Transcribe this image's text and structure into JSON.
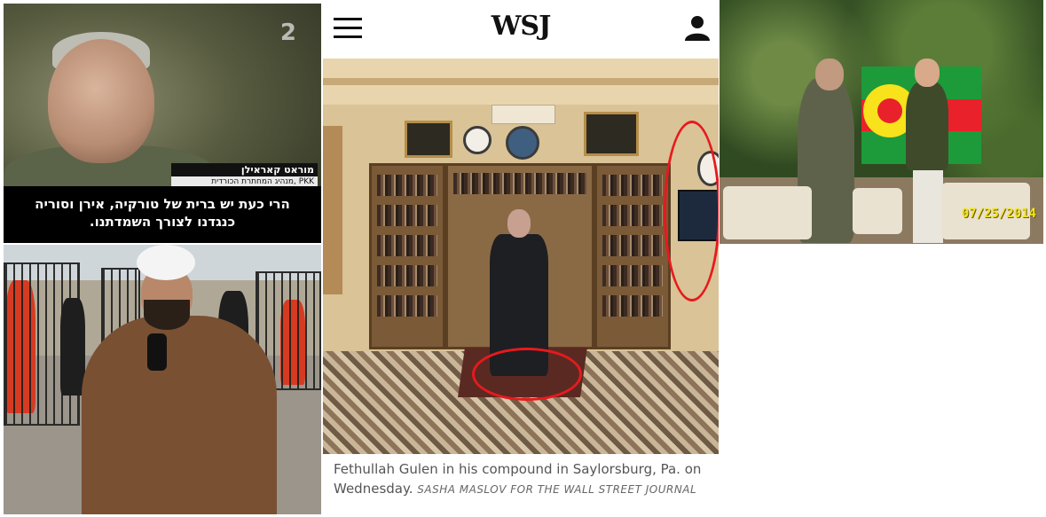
{
  "tv_frame": {
    "channel": "2",
    "name": "מוראט קאראילן",
    "role": "PKK ,מנהיג המחתרת הכורדית",
    "subtitle_line1": "הרי כעת יש ברית של טורקיה, אירן וסוריה",
    "subtitle_line2": "כנגדנו לצורך השמדתנו."
  },
  "wsj": {
    "logo": "WSJ",
    "caption": "Fethullah Gulen in his compound in Saylorsburg, Pa. on Wednesday.",
    "credit": "SASHA MASLOV FOR THE WALL STREET JOURNAL",
    "accent_color": "#e8191e"
  },
  "garden_photo": {
    "date_stamp": "07/25/2014"
  },
  "icons": {
    "menu": "hamburger-menu-icon",
    "account": "user-account-icon"
  }
}
